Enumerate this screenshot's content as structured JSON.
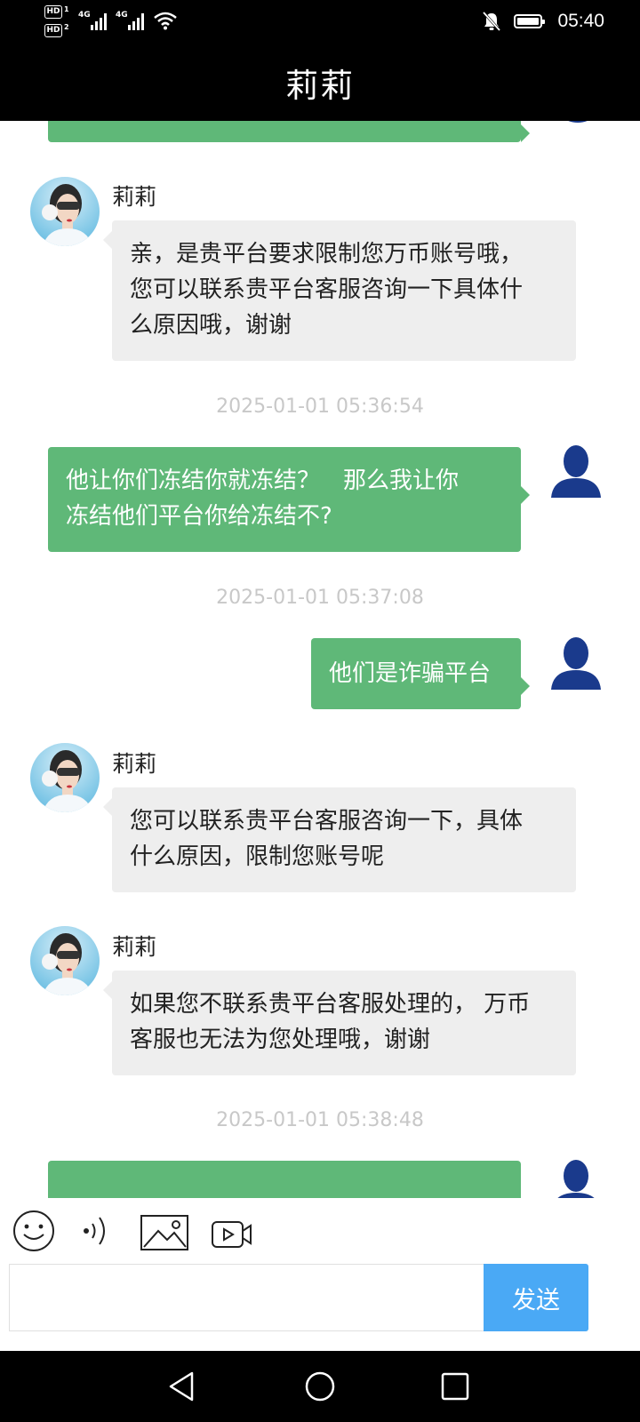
{
  "status_bar": {
    "time": "05:40",
    "sim1": "HD",
    "sim1_index": "1",
    "sim2": "HD",
    "sim2_index": "2",
    "network1": "4G",
    "network2": "4G"
  },
  "header": {
    "title": "莉莉"
  },
  "messages": [
    {
      "sender": "莉莉",
      "direction": "incoming",
      "text_lines": [
        "亲，是贵平台要求限制您万币账号哦，",
        "您可以联系贵平台客服咨询一下具体什",
        "么原因哦，谢谢"
      ]
    },
    {
      "timestamp": "2025-01-01 05:36:54",
      "direction": "outgoing",
      "text_lines": [
        "他让你们冻结你就冻结？　那么我让你",
        "冻结他们平台你给冻结不?"
      ]
    },
    {
      "timestamp": "2025-01-01 05:37:08",
      "direction": "outgoing",
      "text_lines": [
        "他们是诈骗平台"
      ]
    },
    {
      "sender": "莉莉",
      "direction": "incoming",
      "text_lines": [
        "您可以联系贵平台客服咨询一下，具体",
        "什么原因，限制您账号呢"
      ]
    },
    {
      "sender": "莉莉",
      "direction": "incoming",
      "text_lines": [
        "如果您不联系贵平台客服处理的， 万币",
        "客服也无法为您处理哦，谢谢"
      ]
    },
    {
      "timestamp": "2025-01-01 05:38:48",
      "direction": "outgoing"
    }
  ],
  "input": {
    "placeholder": "",
    "send_label": "发送"
  },
  "toolbar": {
    "icons": [
      "emoji-icon",
      "voice-icon",
      "image-icon",
      "video-icon"
    ]
  },
  "colors": {
    "outgoing_bubble": "#5fb878",
    "incoming_bubble": "#eeeeee",
    "send_button": "#4aa9f5",
    "timestamp": "#c8c8c8",
    "user_avatar": "#1a3a8c"
  }
}
